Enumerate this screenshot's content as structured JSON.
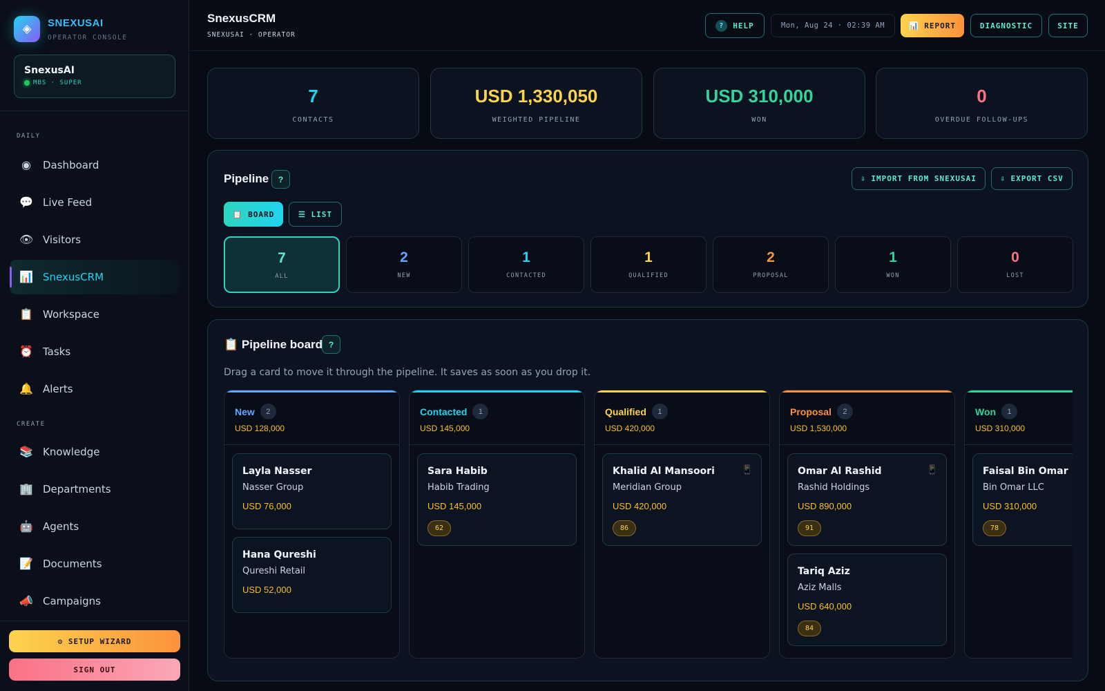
{
  "brand": {
    "logo_glyph": "◈",
    "name": "SNEXUSAI",
    "subtitle": "OPERATOR CONSOLE"
  },
  "account": {
    "name": "SnexusAI",
    "role": "MBS · SUPER"
  },
  "sidebar": {
    "daily_label": "DAILY",
    "create_label": "CREATE",
    "daily": [
      {
        "icon": "◉",
        "label": "Dashboard"
      },
      {
        "icon": "💬",
        "label": "Live Feed"
      },
      {
        "icon": "👁",
        "label": "Visitors"
      },
      {
        "icon": "📊",
        "label": "SnexusCRM",
        "active": true
      },
      {
        "icon": "📋",
        "label": "Workspace"
      },
      {
        "icon": "⏰",
        "label": "Tasks"
      },
      {
        "icon": "🔔",
        "label": "Alerts"
      }
    ],
    "create": [
      {
        "icon": "📚",
        "label": "Knowledge"
      },
      {
        "icon": "🏢",
        "label": "Departments"
      },
      {
        "icon": "🤖",
        "label": "Agents"
      },
      {
        "icon": "📝",
        "label": "Documents"
      },
      {
        "icon": "📣",
        "label": "Campaigns"
      }
    ],
    "setup_wizard": "⚙ SETUP WIZARD",
    "sign_out": "SIGN OUT"
  },
  "header": {
    "title": "SnexusCRM",
    "breadcrumb": "SNEXUSAI · OPERATOR",
    "help": "HELP",
    "help_glyph": "?",
    "datetime": "Mon, Aug 24 · 02:39 AM",
    "report": "📊 REPORT",
    "diagnostic": "DIAGNOSTIC",
    "site": "SITE"
  },
  "stats": [
    {
      "value": "7",
      "label": "CONTACTS",
      "color": "#22d3ee"
    },
    {
      "value": "USD 1,330,050",
      "label": "WEIGHTED PIPELINE",
      "color": "#fcd34d"
    },
    {
      "value": "USD 310,000",
      "label": "WON",
      "color": "#34d399"
    },
    {
      "value": "0",
      "label": "OVERDUE FOLLOW-UPS",
      "color": "#fb7185"
    }
  ],
  "pipeline": {
    "title": "Pipeline",
    "help_glyph": "?",
    "import_label": "⇩ IMPORT FROM SNEXUSAI",
    "export_label": "⇩ EXPORT CSV",
    "board_label": "📋 BOARD",
    "list_label": "☰ LIST",
    "stages": [
      {
        "count": "7",
        "label": "ALL",
        "color": "#5eead4",
        "active": true
      },
      {
        "count": "2",
        "label": "NEW",
        "color": "#60a5fa"
      },
      {
        "count": "1",
        "label": "CONTACTED",
        "color": "#22d3ee"
      },
      {
        "count": "1",
        "label": "QUALIFIED",
        "color": "#fcd34d"
      },
      {
        "count": "2",
        "label": "PROPOSAL",
        "color": "#fb923c"
      },
      {
        "count": "1",
        "label": "WON",
        "color": "#34d399"
      },
      {
        "count": "0",
        "label": "LOST",
        "color": "#fb7185"
      }
    ]
  },
  "board": {
    "title": "📋 Pipeline board",
    "help_glyph": "?",
    "description": "Drag a card to move it through the pipeline. It saves as soon as you drop it.",
    "columns": [
      {
        "name": "New",
        "count": "2",
        "total": "USD 128,000",
        "color": "#60a5fa",
        "cards": [
          {
            "name": "Layla Nasser",
            "company": "Nasser Group",
            "amount": "USD 76,000"
          },
          {
            "name": "Hana Qureshi",
            "company": "Qureshi Retail",
            "amount": "USD 52,000"
          }
        ]
      },
      {
        "name": "Contacted",
        "count": "1",
        "total": "USD 145,000",
        "color": "#22d3ee",
        "cards": [
          {
            "name": "Sara Habib",
            "company": "Habib Trading",
            "amount": "USD 145,000",
            "score": "62"
          }
        ]
      },
      {
        "name": "Qualified",
        "count": "1",
        "total": "USD 420,000",
        "color": "#fcd34d",
        "cards": [
          {
            "name": "Khalid Al Mansoori",
            "company": "Meridian Group",
            "amount": "USD 420,000",
            "score": "86",
            "phone": "📱"
          }
        ]
      },
      {
        "name": "Proposal",
        "count": "2",
        "total": "USD 1,530,000",
        "color": "#fb923c",
        "cards": [
          {
            "name": "Omar Al Rashid",
            "company": "Rashid Holdings",
            "amount": "USD 890,000",
            "score": "91",
            "phone": "📱"
          },
          {
            "name": "Tariq Aziz",
            "company": "Aziz Malls",
            "amount": "USD 640,000",
            "score": "84"
          }
        ]
      },
      {
        "name": "Won",
        "count": "1",
        "total": "USD 310,000",
        "color": "#34d399",
        "cards": [
          {
            "name": "Faisal Bin Omar",
            "company": "Bin Omar LLC",
            "amount": "USD 310,000",
            "score": "78"
          }
        ]
      }
    ]
  }
}
